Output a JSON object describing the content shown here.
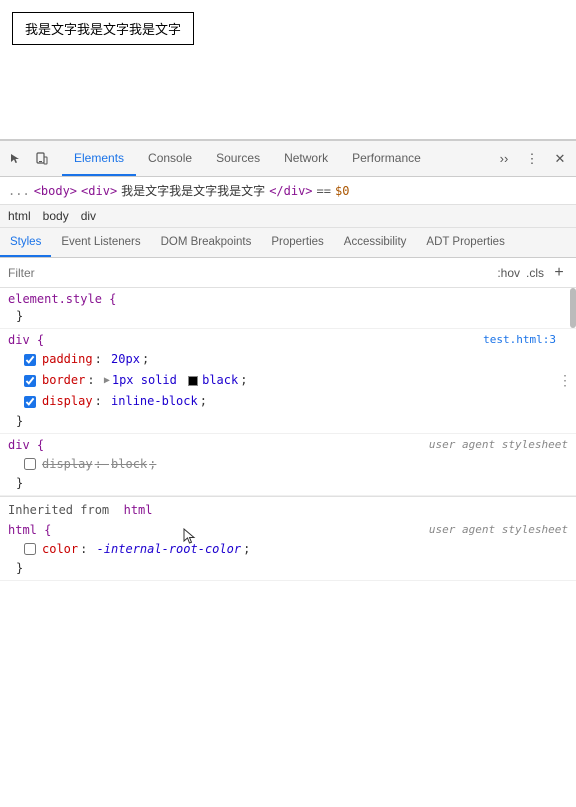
{
  "preview": {
    "box_text": "我是文字我是文字我是文字"
  },
  "toolbar": {
    "icons": [
      "☰",
      "📱"
    ],
    "tabs": [
      {
        "label": "Elements",
        "active": true
      },
      {
        "label": "Console",
        "active": false
      },
      {
        "label": "Sources",
        "active": false
      },
      {
        "label": "Network",
        "active": false
      },
      {
        "label": "Performance",
        "active": false
      }
    ],
    "more_icon": "⋮",
    "settings_icon": "⋮",
    "close_icon": "✕"
  },
  "element_selected": {
    "dots": "...",
    "pre_tag": "<body>",
    "indent": "  ",
    "tag_open": "<div>",
    "content": "我是文字我是文字我是文字",
    "tag_close": "</div>",
    "eq": "==",
    "dollar": "$0"
  },
  "breadcrumb": {
    "items": [
      "html",
      "body",
      "div"
    ]
  },
  "sub_tabs": {
    "items": [
      {
        "label": "Styles",
        "active": true
      },
      {
        "label": "Event Listeners",
        "active": false
      },
      {
        "label": "DOM Breakpoints",
        "active": false
      },
      {
        "label": "Properties",
        "active": false
      },
      {
        "label": "Accessibility",
        "active": false
      },
      {
        "label": "ADT Properties",
        "active": false
      }
    ]
  },
  "filter": {
    "placeholder": "Filter",
    "hov": ":hov",
    "cls": ".cls",
    "plus": "+"
  },
  "styles": {
    "rules": [
      {
        "id": "element-style",
        "selector": "element.style {",
        "close": "}",
        "properties": []
      },
      {
        "id": "div-rule",
        "selector": "div {",
        "file": "test.html:3",
        "close": "}",
        "properties": [
          {
            "checked": true,
            "name": "padding",
            "value": "20px"
          },
          {
            "checked": true,
            "name": "border",
            "value": "1px solid",
            "has_swatch": true,
            "swatch_color": "#000",
            "value2": "black"
          },
          {
            "checked": true,
            "name": "display",
            "value": "inline-block"
          }
        ]
      },
      {
        "id": "div-user-agent",
        "selector": "div {",
        "user_agent": "user agent stylesheet",
        "close": "}",
        "properties": [
          {
            "checked": false,
            "name": "display",
            "value": "block",
            "strikethrough": true
          }
        ]
      }
    ],
    "inherited": {
      "label": "Inherited from",
      "tag": "html",
      "rules": [
        {
          "id": "html-rule",
          "selector": "html {",
          "user_agent": "user agent stylesheet",
          "close": "}",
          "properties": [
            {
              "checked": false,
              "name": "color",
              "value": "-internal-root-color",
              "italic": true
            }
          ]
        }
      ]
    }
  },
  "cursor": {
    "symbol": "↖"
  }
}
